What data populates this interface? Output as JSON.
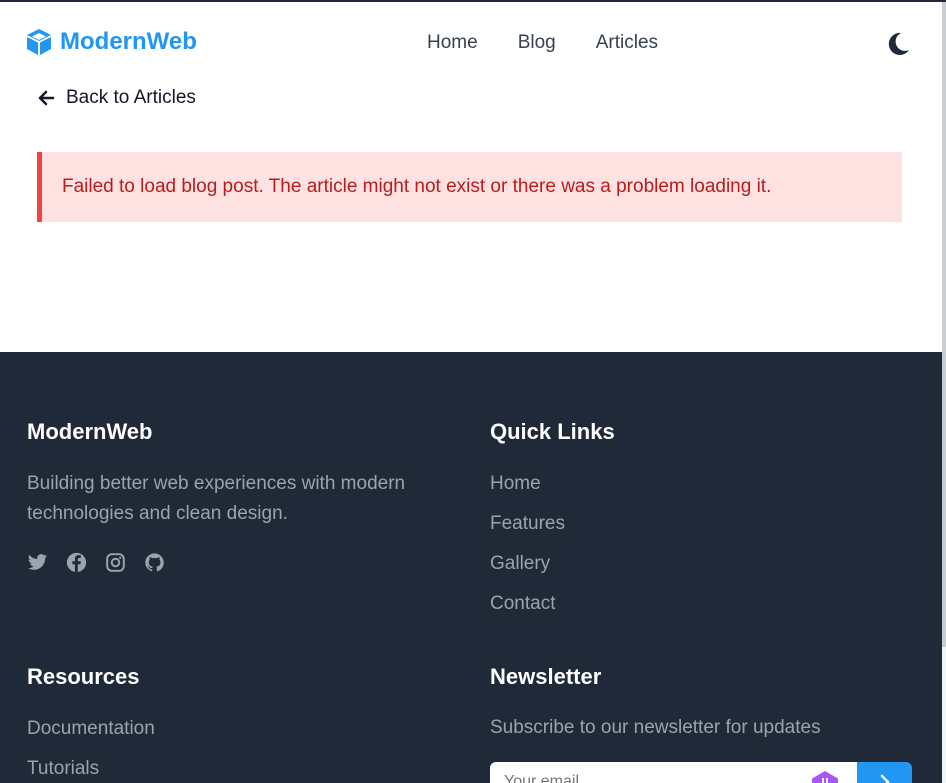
{
  "brand": {
    "name": "ModernWeb",
    "icon": "cube-icon",
    "color": "#2196f3"
  },
  "nav": {
    "items": [
      "Home",
      "Blog",
      "Articles"
    ],
    "theme_toggle_icon": "moon-icon"
  },
  "back_link": {
    "label": "Back to Articles",
    "icon": "arrow-left-icon"
  },
  "alert": {
    "message": "Failed to load blog post. The article might not exist or there was a problem loading it.",
    "bg_color": "#fee2e2",
    "accent_color": "#ef4444",
    "text_color": "#b91c1c"
  },
  "footer": {
    "about": {
      "title": "ModernWeb",
      "description": "Building better web experiences with modern technologies and clean design.",
      "social_icons": [
        "twitter-icon",
        "facebook-icon",
        "instagram-icon",
        "github-icon"
      ]
    },
    "quick_links": {
      "title": "Quick Links",
      "items": [
        "Home",
        "Features",
        "Gallery",
        "Contact"
      ]
    },
    "resources": {
      "title": "Resources",
      "items": [
        "Documentation",
        "Tutorials"
      ]
    },
    "newsletter": {
      "title": "Newsletter",
      "description": "Subscribe to our newsletter for updates",
      "input_placeholder": "Your email",
      "submit_icon": "send-icon"
    },
    "bg_color": "#1f2937"
  }
}
